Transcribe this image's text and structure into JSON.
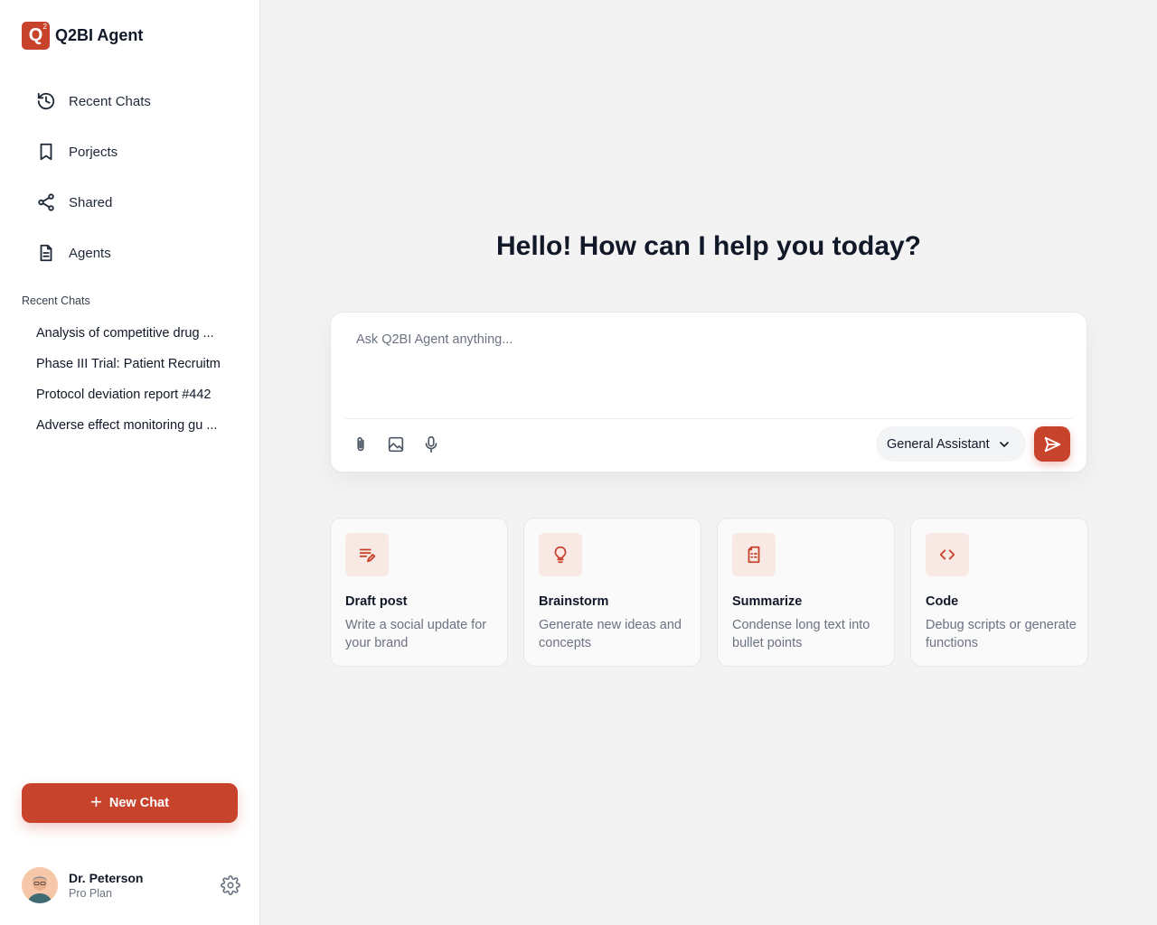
{
  "app": {
    "name": "Q2BI Agent",
    "logo_letter": "Q",
    "logo_sup": "2"
  },
  "nav": [
    {
      "label": "Recent Chats",
      "icon": "history-icon"
    },
    {
      "label": "Porjects",
      "icon": "bookmark-icon"
    },
    {
      "label": "Shared",
      "icon": "share-icon"
    },
    {
      "label": "Agents",
      "icon": "document-icon"
    }
  ],
  "recent": {
    "heading": "Recent Chats",
    "items": [
      "Analysis of competitive drug ...",
      "Phase III Trial: Patient Recruitm",
      "Protocol deviation report #442",
      "Adverse effect monitoring gu ..."
    ]
  },
  "new_chat": {
    "label": "New Chat"
  },
  "user": {
    "name": "Dr. Peterson",
    "plan": "Pro Plan"
  },
  "main": {
    "greeting": "Hello! How can I help you today?",
    "composer": {
      "placeholder": "Ask Q2BI Agent anything...",
      "model": "General Assistant"
    },
    "cards": [
      {
        "title": "Draft post",
        "desc": "Write a social update for your brand",
        "icon": "edit-list-icon"
      },
      {
        "title": "Brainstorm",
        "desc": "Generate new ideas and concepts",
        "icon": "lightbulb-icon"
      },
      {
        "title": "Summarize",
        "desc": "Condense long text into bullet points",
        "icon": "file-text-icon"
      },
      {
        "title": "Code",
        "desc": "Debug scripts or generate functions",
        "icon": "code-icon"
      }
    ]
  },
  "colors": {
    "accent": "#c8432c",
    "accent_soft": "#f9e9e5",
    "background": "#f3f3f3"
  }
}
